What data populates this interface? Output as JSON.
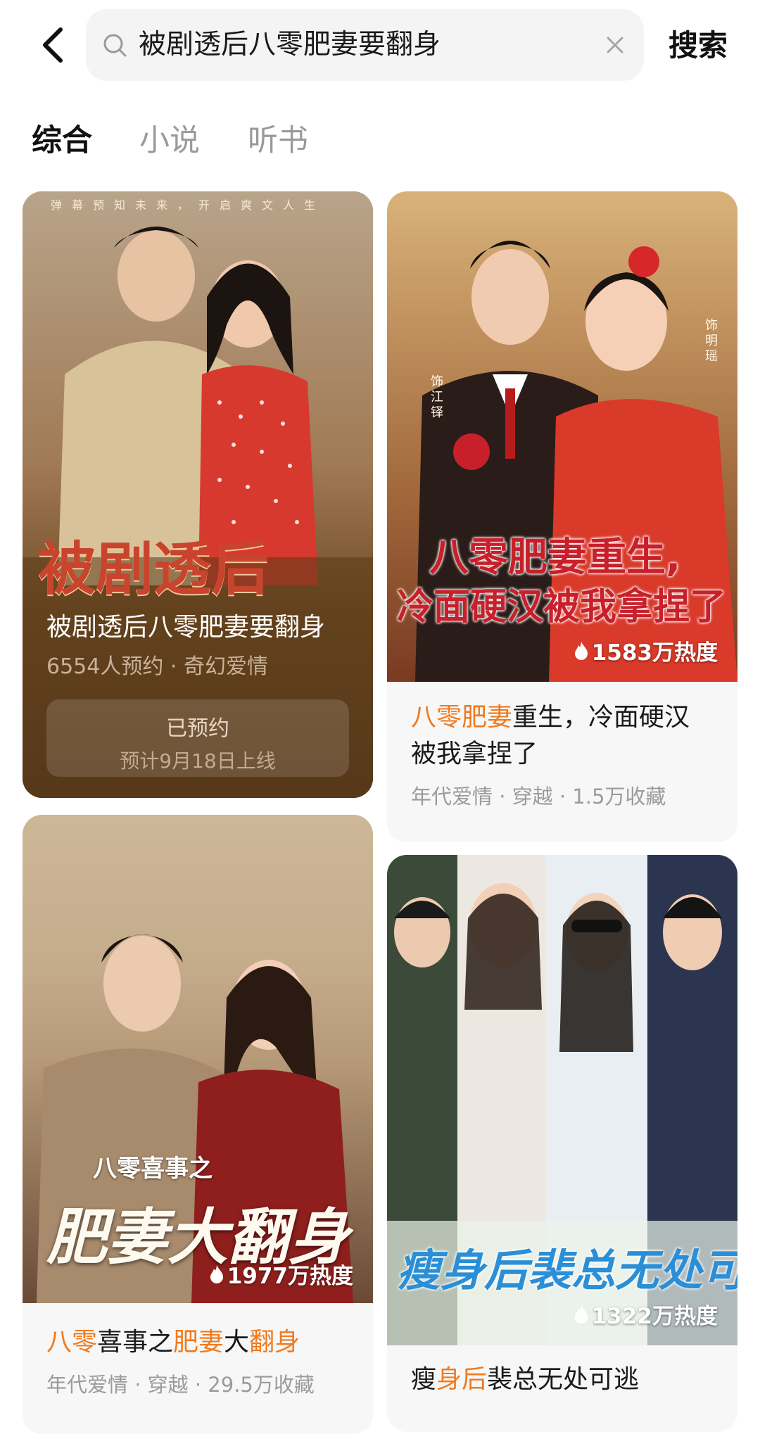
{
  "header": {
    "search_query": "被剧透后八零肥妻要翻身",
    "search_button": "搜索"
  },
  "tabs": [
    {
      "label": "综合",
      "active": true
    },
    {
      "label": "小说",
      "active": false
    },
    {
      "label": "听书",
      "active": false
    }
  ],
  "cards": [
    {
      "poster_tagline": "弹幕预知未来，开启爽文人生",
      "poster_title": "被剧透后",
      "title": "被剧透后八零肥妻要翻身",
      "meta": "6554人预约 · 奇幻爱情",
      "reserve_status": "已预约",
      "reserve_note": "预计9月18日上线"
    },
    {
      "poster_title_line1": "八零肥妻重生,",
      "poster_title_line2": "冷面硬汉被我拿捏了",
      "poster_cast_1": "饰江铎",
      "poster_cast_2": "饰明瑶",
      "heat": "1583万热度",
      "title_hl1": "八零肥妻",
      "title_rest": "重生，冷面硬汉被我拿捏了",
      "meta": "年代爱情 · 穿越 · 1.5万收藏"
    },
    {
      "poster_subtitle": "八零喜事之",
      "poster_title": "肥妻大翻身",
      "heat": "1977万热度",
      "title_parts": [
        "八零",
        "喜事之",
        "肥妻",
        "大",
        "翻身"
      ],
      "meta": "年代爱情 · 穿越 · 29.5万收藏"
    },
    {
      "poster_title": "瘦身后裴总无处可逃",
      "heat": "1322万热度",
      "title_parts": [
        "瘦",
        "身后",
        "裴总无处可逃"
      ]
    }
  ],
  "icons": {
    "back": "back-arrow-icon",
    "search": "search-icon",
    "clear": "close-icon",
    "heat": "flame-icon"
  },
  "colors": {
    "highlight": "#f07a1e",
    "card1_overlay": "#5a3a18"
  }
}
